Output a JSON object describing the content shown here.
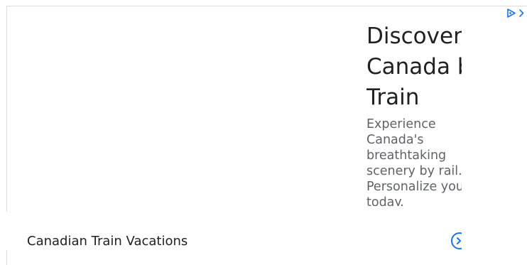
{
  "ad": {
    "headline": "Discover Canada by Train",
    "description": "Experience Canada's breathtaking scenery by rail. Personalize your trip today.",
    "advertiser": "Canadian Train Vacations",
    "adchoices_icon": "adchoices-triangle-icon",
    "close_icon": "chevron-right-icon",
    "cta_icon": "arrow-circle-icon",
    "colors": {
      "accent": "#1a73e8",
      "headline": "#202124",
      "body": "#5f6368",
      "border": "#dadce0"
    }
  }
}
